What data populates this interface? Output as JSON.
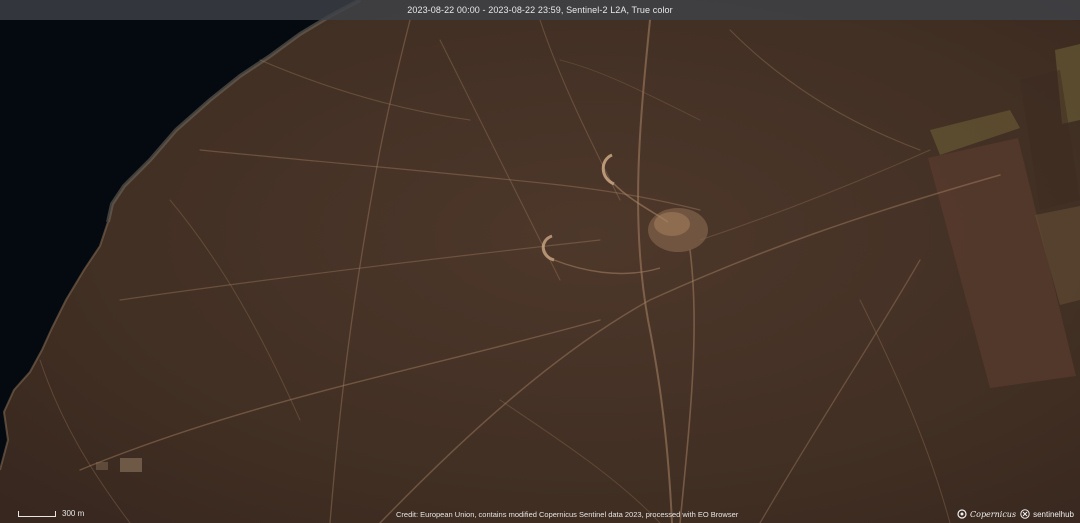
{
  "header": {
    "caption": "2023-08-22 00:00 - 2023-08-22 23:59, Sentinel-2 L2A, True color"
  },
  "scale": {
    "label": "300 m"
  },
  "footer": {
    "credit": "Credit: European Union, contains modified Copernicus Sentinel data 2023, processed with EO Browser"
  },
  "logos": {
    "copernicus": "Copernicus",
    "sentinelhub": "sentinelhub"
  },
  "colors": {
    "sea": "#060b11",
    "land": "#4a3629",
    "track": "#b38c6b",
    "field_light": "#6a5a35",
    "field_dark": "#5a3f2e",
    "ui_text": "#e6e6e6"
  }
}
